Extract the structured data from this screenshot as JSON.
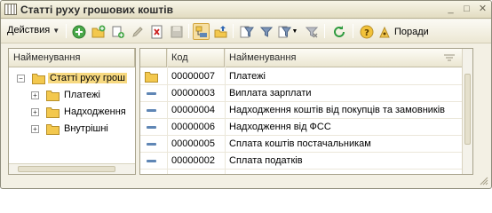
{
  "window": {
    "title": "Статті руху грошових коштів"
  },
  "toolbar": {
    "actions_label": "Действия",
    "help_label": "Поради",
    "buttons": [
      "add-icon",
      "add-folder-icon",
      "copy-icon",
      "edit-icon",
      "delete-icon",
      "save-icon",
      "hierarchy-view-icon",
      "level-up-icon",
      "filter-icon",
      "filter-list-icon",
      "clear-filter-icon",
      "refresh-icon",
      "help-icon",
      "tips-icon"
    ]
  },
  "tree": {
    "header": "Найменування",
    "root": "Статті руху грош",
    "children": [
      "Платежі",
      "Надходження",
      "Внутрішні"
    ]
  },
  "grid": {
    "columns": [
      "Код",
      "Найменування"
    ],
    "rows": [
      {
        "type": "folder",
        "code": "00000007",
        "name": "Платежі"
      },
      {
        "type": "item",
        "code": "00000003",
        "name": "Виплата зарплати"
      },
      {
        "type": "item",
        "code": "00000004",
        "name": "Надходження коштів від покупців та замовників"
      },
      {
        "type": "item",
        "code": "00000006",
        "name": "Надходження від ФСС"
      },
      {
        "type": "item",
        "code": "00000005",
        "name": "Сплата коштів постачальникам"
      },
      {
        "type": "item",
        "code": "00000002",
        "name": "Сплата податків"
      }
    ]
  },
  "colors": {
    "folder": "#f3c84e",
    "selection": "#f7d980",
    "item_dash": "#5f86b5"
  }
}
